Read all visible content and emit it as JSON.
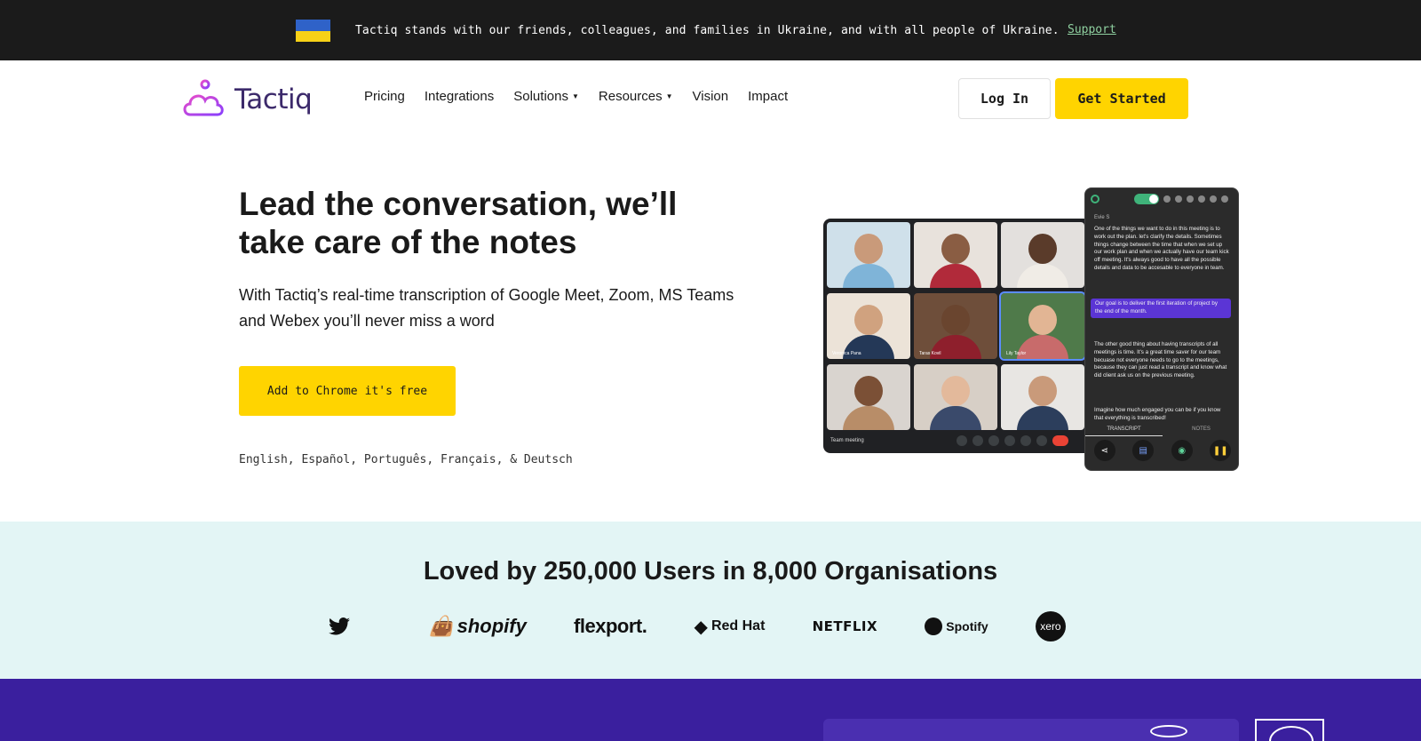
{
  "banner": {
    "message": "Tactiq stands with our friends, colleagues, and families in Ukraine, and with all people of Ukraine.",
    "link_label": "Support"
  },
  "header": {
    "logo_text": "Tactiq",
    "nav": [
      {
        "label": "Pricing",
        "dropdown": false
      },
      {
        "label": "Integrations",
        "dropdown": false
      },
      {
        "label": "Solutions",
        "dropdown": true
      },
      {
        "label": "Resources",
        "dropdown": true
      },
      {
        "label": "Vision",
        "dropdown": false
      },
      {
        "label": "Impact",
        "dropdown": false
      }
    ],
    "login_label": "Log In",
    "cta_label": "Get Started"
  },
  "hero": {
    "title": "Lead the conversation, we’ll take care of the notes",
    "subtitle": "With Tactiq’s real-time transcription of Google Meet, Zoom, MS Teams and Webex you’ll never miss a word",
    "cta_main": "Add to Chrome",
    "cta_suffix": "it's free",
    "languages": "English, Español, Português, Français, & Deutsch"
  },
  "mockup": {
    "meeting_name": "Team meeting",
    "participants": [
      "",
      "",
      "",
      "Veronica Pana",
      "Taras Kovil",
      "Lily Taylor",
      "",
      "",
      ""
    ],
    "panel": {
      "toggle_label": "ON",
      "speaker": "Evie S",
      "paragraph_1": "One of the things we want to do in this meeting is to work out the plan. let's clarify the details. Sometimes things change between the time that when we set up our work plan and when we actually have our team kick off meeting. It's always good to have all the possible details and data to be accesable to everyone in team.",
      "highlight": "Our goal is to deliver the first iteration of project by the end of the month.",
      "paragraph_2": "The other good thing about having transcripts of all meetings is time. It's a great time saver for our team becuase not everyone needs to go to the meetings, because they can just read a transcript and know what did client ask us on the previous meeting.",
      "paragraph_3": "Imagine how much engaged you can be if you know that everything is transcribed!",
      "tab_transcript": "TRANSCRIPT",
      "tab_notes": "NOTES"
    }
  },
  "social_proof": {
    "title": "Loved by 250,000 Users in 8,000 Organisations",
    "logos": [
      "shopify",
      "flexport.",
      "Red Hat",
      "NETFLIX",
      "Spotify",
      "xero"
    ]
  },
  "colors": {
    "accent": "#ffd400",
    "banner_bg": "#1b1b1b",
    "loved_bg": "#e3f5f5",
    "purple_bg": "#3a1f9e"
  }
}
